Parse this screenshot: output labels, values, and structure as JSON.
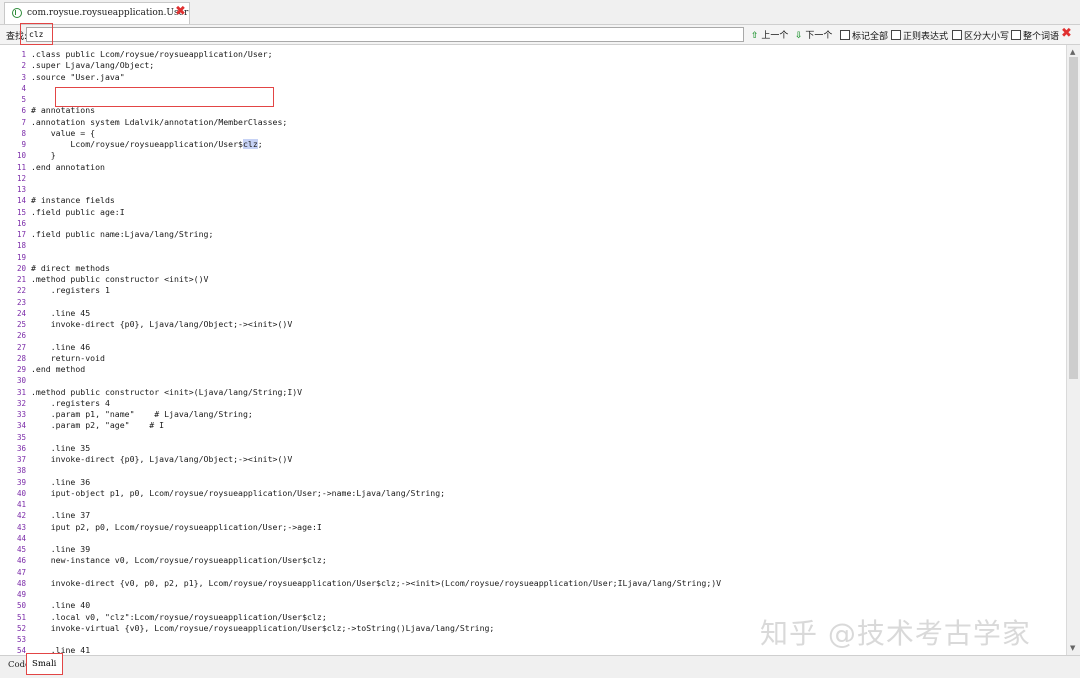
{
  "tab": {
    "title": "com.roysue.roysueapplication.User",
    "close_icon": "close-icon"
  },
  "findbar": {
    "label": "查找:",
    "query": "clz",
    "prev_label": "上一个",
    "next_label": "下一个",
    "prev_arrow": "⇧",
    "next_arrow": "⇩",
    "options": [
      {
        "label": "标记全部",
        "checked": false
      },
      {
        "label": "正则表达式",
        "checked": false
      },
      {
        "label": "区分大小写",
        "checked": false
      },
      {
        "label": "整个词语",
        "checked": false
      }
    ],
    "close_glyph": "✖"
  },
  "code_lines": [
    ".class public Lcom/roysue/roysueapplication/User;",
    ".super Ljava/lang/Object;",
    ".source \"User.java\"",
    "",
    "",
    "# annotations",
    ".annotation system Ldalvik/annotation/MemberClasses;",
    "    value = {",
    "        Lcom/roysue/roysueapplication/User$clz;",
    "    }",
    ".end annotation",
    "",
    "",
    "# instance fields",
    ".field public age:I",
    "",
    ".field public name:Ljava/lang/String;",
    "",
    "",
    "# direct methods",
    ".method public constructor <init>()V",
    "    .registers 1",
    "",
    "    .line 45",
    "    invoke-direct {p0}, Ljava/lang/Object;-><init>()V",
    "",
    "    .line 46",
    "    return-void",
    ".end method",
    "",
    ".method public constructor <init>(Ljava/lang/String;I)V",
    "    .registers 4",
    "    .param p1, \"name\"    # Ljava/lang/String;",
    "    .param p2, \"age\"    # I",
    "",
    "    .line 35",
    "    invoke-direct {p0}, Ljava/lang/Object;-><init>()V",
    "",
    "    .line 36",
    "    iput-object p1, p0, Lcom/roysue/roysueapplication/User;->name:Ljava/lang/String;",
    "",
    "    .line 37",
    "    iput p2, p0, Lcom/roysue/roysueapplication/User;->age:I",
    "",
    "    .line 39",
    "    new-instance v0, Lcom/roysue/roysueapplication/User$clz;",
    "",
    "    invoke-direct {v0, p0, p2, p1}, Lcom/roysue/roysueapplication/User$clz;-><init>(Lcom/roysue/roysueapplication/User;ILjava/lang/String;)V",
    "",
    "    .line 40",
    "    .local v0, \"clz\":Lcom/roysue/roysueapplication/User$clz;",
    "    invoke-virtual {v0}, Lcom/roysue/roysueapplication/User$clz;->toString()Ljava/lang/String;",
    "",
    "    .line 41",
    ""
  ],
  "highlighted_line": 9,
  "bottom_tabs": {
    "code": "Code",
    "smali": "Smali"
  },
  "watermark": "知乎 @技术考古学家",
  "colors": {
    "highlight_box": "#e24545",
    "line_number": "#7a2aa8",
    "match_bg": "#c6d2f5"
  }
}
